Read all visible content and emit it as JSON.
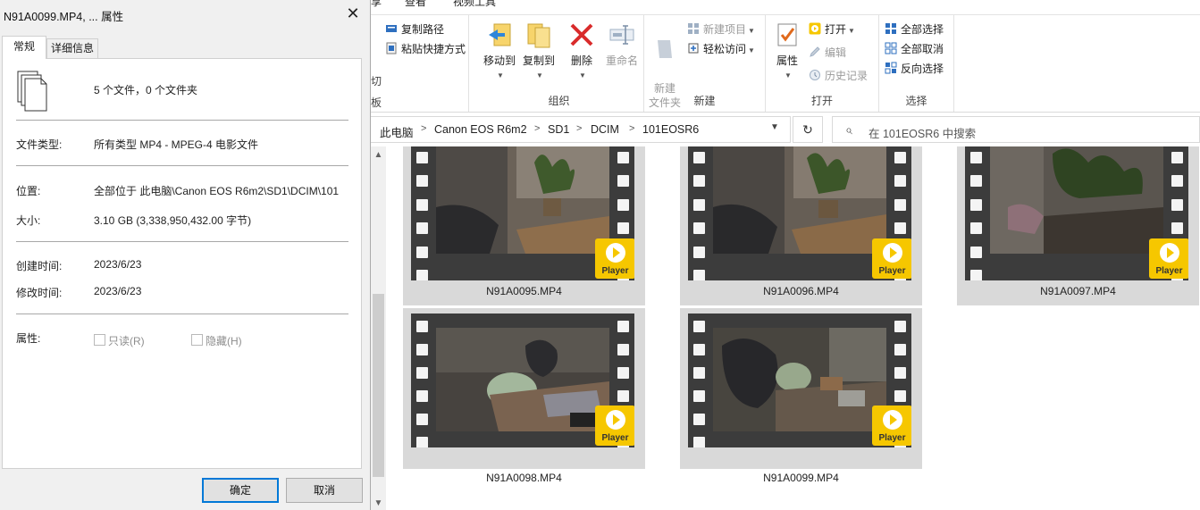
{
  "explorer": {
    "ribbon_tabs": [
      "享",
      "查看",
      "视频工具"
    ],
    "clipboard": {
      "copy_path": "复制路径",
      "paste_shortcut": "粘贴快捷方式",
      "partial_labels": [
        "切",
        "板"
      ]
    },
    "organize": {
      "label": "组织",
      "move_to": "移动到",
      "copy_to": "复制到",
      "delete": "删除",
      "rename": "重命名"
    },
    "new": {
      "label": "新建",
      "new_folder": "新建\n文件夹",
      "new_item": "新建项目",
      "easy_access": "轻松访问"
    },
    "open": {
      "label": "打开",
      "properties": "属性",
      "open": "打开",
      "edit": "编辑",
      "history": "历史记录"
    },
    "select": {
      "label": "选择",
      "select_all": "全部选择",
      "select_none": "全部取消",
      "invert": "反向选择"
    },
    "breadcrumb": [
      "此电脑",
      "Canon EOS R6m2",
      "SD1",
      "DCIM",
      "101EOSR6"
    ],
    "search_placeholder": "在 101EOSR6 中搜索",
    "files": [
      {
        "name": "N91A0095.MP4",
        "selected": true
      },
      {
        "name": "N91A0096.MP4",
        "selected": true
      },
      {
        "name": "N91A0097.MP4",
        "selected": true
      },
      {
        "name": "N91A0098.MP4",
        "selected": true
      },
      {
        "name": "N91A0099.MP4",
        "selected": true
      }
    ],
    "player_badge": "Player"
  },
  "dialog": {
    "title": "N91A0099.MP4, ... 属性",
    "tabs": [
      "常规",
      "详细信息"
    ],
    "summary": "5 个文件，0 个文件夹",
    "type_label": "文件类型:",
    "type_value": "所有类型 MP4 - MPEG-4 电影文件",
    "location_label": "位置:",
    "location_value": "全部位于 此电脑\\Canon EOS R6m2\\SD1\\DCIM\\101",
    "size_label": "大小:",
    "size_value": "3.10 GB (3,338,950,432.00 字节)",
    "created_label": "创建时间:",
    "created_value": "2023/6/23",
    "modified_label": "修改时间:",
    "modified_value": "2023/6/23",
    "attributes_label": "属性:",
    "readonly_label": "只读(R)",
    "hidden_label": "隐藏(H)",
    "ok": "确定",
    "cancel": "取消"
  }
}
